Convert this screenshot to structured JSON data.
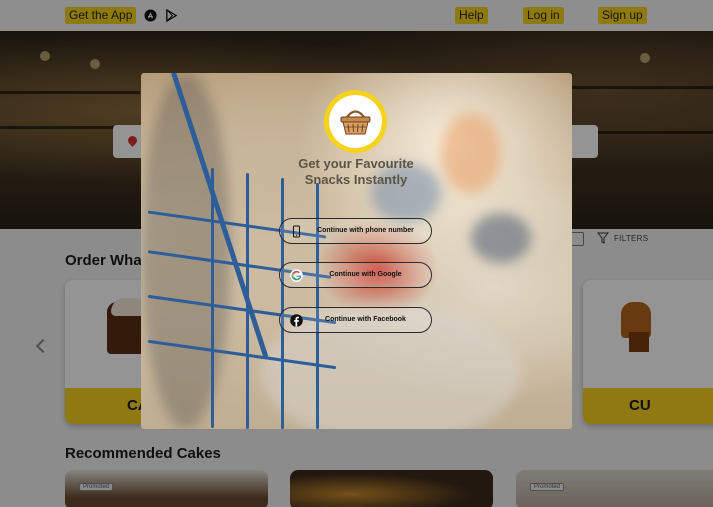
{
  "topbar": {
    "get_app": "Get the App",
    "app_store_icon": "app-store-icon",
    "play_store_icon": "play-store-icon",
    "help": "Help",
    "login": "Log in",
    "signup": "Sign up"
  },
  "sections": {
    "order_title": "Order What",
    "recommended_title": "Recommended Cakes"
  },
  "filters": {
    "label": "FILTERS"
  },
  "categories": [
    {
      "label": "CA"
    },
    {
      "label": "CU"
    }
  ],
  "recommended": [
    {
      "badge": "Promoted"
    },
    {
      "badge": ""
    },
    {
      "badge": "Promoted"
    }
  ],
  "modal": {
    "headline_line1": "Get your Favourite",
    "headline_line2": "Snacks Instantly",
    "phone_btn": "Continue with phone number",
    "google_btn": "Continue with Google",
    "facebook_btn": "Continue with Facebook"
  },
  "colors": {
    "accent_yellow": "#f5d21c",
    "facebook_blue": "#1877f2",
    "overlay": "rgba(0,0,0,0.42)"
  }
}
